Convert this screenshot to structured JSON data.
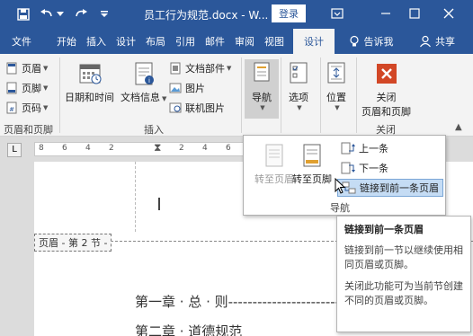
{
  "titlebar": {
    "title": "员工行为规范.docx - W...",
    "login": "登录",
    "qat": [
      "save-icon",
      "undo-icon",
      "redo-icon",
      "customize-icon"
    ],
    "window_buttons": [
      "ribbon-options-icon",
      "minimize-icon",
      "maximize-icon",
      "close-icon"
    ]
  },
  "tabs": {
    "file": "文件",
    "items": [
      "开始",
      "插入",
      "设计",
      "布局",
      "引用",
      "邮件",
      "审阅",
      "视图"
    ],
    "active": "设计",
    "tell": "告诉我",
    "share": "共享"
  },
  "ribbon": {
    "header_footer": {
      "items": [
        "页眉",
        "页脚",
        "页码"
      ],
      "group_label": "页眉和页脚"
    },
    "insert": {
      "datetime": "日期和时间",
      "docinfo": "文档信息",
      "quickparts": "文档部件",
      "picture": "图片",
      "online_picture": "联机图片",
      "group_label": "插入"
    },
    "nav": "导航",
    "options": "选项",
    "position": "位置",
    "close": {
      "line1": "关闭",
      "line2": "页眉和页脚",
      "group_label": "关闭"
    }
  },
  "ruler": {
    "ticks": [
      "8",
      "6",
      "4",
      "2",
      "",
      "2",
      "4",
      "6",
      "8",
      "10",
      "12"
    ]
  },
  "panel": {
    "goto_header": "转至页眉",
    "goto_footer": "转至页脚",
    "previous": "上一条",
    "next": "下一条",
    "link_previous": "链接到前一条页眉",
    "group_label": "导航"
  },
  "document": {
    "header_tag": "页眉 - 第 2 节 -",
    "line1": "第一章 · 总 · 则-----------------------------",
    "line2": "第二章 · 道德规范"
  },
  "tooltip": {
    "title": "链接到前一条页眉",
    "p1": "链接到前一节以继续使用相同页眉或页脚。",
    "p2": "关闭此功能可为当前节创建不同的页眉或页脚。"
  },
  "colors": {
    "brand": "#2b579a",
    "close_red": "#d24726",
    "hover": "#c5dcf4"
  }
}
